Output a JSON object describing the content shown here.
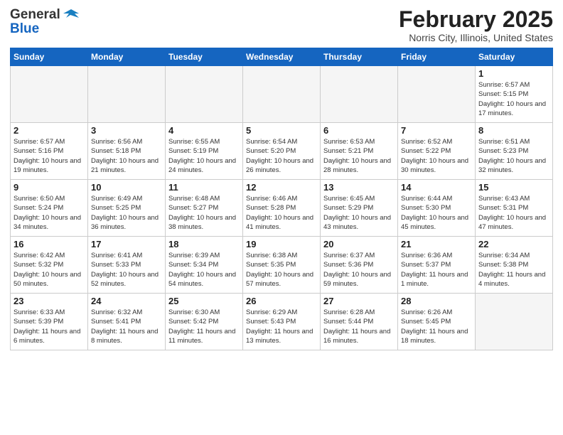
{
  "header": {
    "logo_general": "General",
    "logo_blue": "Blue",
    "title": "February 2025",
    "subtitle": "Norris City, Illinois, United States"
  },
  "days_of_week": [
    "Sunday",
    "Monday",
    "Tuesday",
    "Wednesday",
    "Thursday",
    "Friday",
    "Saturday"
  ],
  "weeks": [
    [
      {
        "day": "",
        "info": ""
      },
      {
        "day": "",
        "info": ""
      },
      {
        "day": "",
        "info": ""
      },
      {
        "day": "",
        "info": ""
      },
      {
        "day": "",
        "info": ""
      },
      {
        "day": "",
        "info": ""
      },
      {
        "day": "1",
        "info": "Sunrise: 6:57 AM\nSunset: 5:15 PM\nDaylight: 10 hours and 17 minutes."
      }
    ],
    [
      {
        "day": "2",
        "info": "Sunrise: 6:57 AM\nSunset: 5:16 PM\nDaylight: 10 hours and 19 minutes."
      },
      {
        "day": "3",
        "info": "Sunrise: 6:56 AM\nSunset: 5:18 PM\nDaylight: 10 hours and 21 minutes."
      },
      {
        "day": "4",
        "info": "Sunrise: 6:55 AM\nSunset: 5:19 PM\nDaylight: 10 hours and 24 minutes."
      },
      {
        "day": "5",
        "info": "Sunrise: 6:54 AM\nSunset: 5:20 PM\nDaylight: 10 hours and 26 minutes."
      },
      {
        "day": "6",
        "info": "Sunrise: 6:53 AM\nSunset: 5:21 PM\nDaylight: 10 hours and 28 minutes."
      },
      {
        "day": "7",
        "info": "Sunrise: 6:52 AM\nSunset: 5:22 PM\nDaylight: 10 hours and 30 minutes."
      },
      {
        "day": "8",
        "info": "Sunrise: 6:51 AM\nSunset: 5:23 PM\nDaylight: 10 hours and 32 minutes."
      }
    ],
    [
      {
        "day": "9",
        "info": "Sunrise: 6:50 AM\nSunset: 5:24 PM\nDaylight: 10 hours and 34 minutes."
      },
      {
        "day": "10",
        "info": "Sunrise: 6:49 AM\nSunset: 5:25 PM\nDaylight: 10 hours and 36 minutes."
      },
      {
        "day": "11",
        "info": "Sunrise: 6:48 AM\nSunset: 5:27 PM\nDaylight: 10 hours and 38 minutes."
      },
      {
        "day": "12",
        "info": "Sunrise: 6:46 AM\nSunset: 5:28 PM\nDaylight: 10 hours and 41 minutes."
      },
      {
        "day": "13",
        "info": "Sunrise: 6:45 AM\nSunset: 5:29 PM\nDaylight: 10 hours and 43 minutes."
      },
      {
        "day": "14",
        "info": "Sunrise: 6:44 AM\nSunset: 5:30 PM\nDaylight: 10 hours and 45 minutes."
      },
      {
        "day": "15",
        "info": "Sunrise: 6:43 AM\nSunset: 5:31 PM\nDaylight: 10 hours and 47 minutes."
      }
    ],
    [
      {
        "day": "16",
        "info": "Sunrise: 6:42 AM\nSunset: 5:32 PM\nDaylight: 10 hours and 50 minutes."
      },
      {
        "day": "17",
        "info": "Sunrise: 6:41 AM\nSunset: 5:33 PM\nDaylight: 10 hours and 52 minutes."
      },
      {
        "day": "18",
        "info": "Sunrise: 6:39 AM\nSunset: 5:34 PM\nDaylight: 10 hours and 54 minutes."
      },
      {
        "day": "19",
        "info": "Sunrise: 6:38 AM\nSunset: 5:35 PM\nDaylight: 10 hours and 57 minutes."
      },
      {
        "day": "20",
        "info": "Sunrise: 6:37 AM\nSunset: 5:36 PM\nDaylight: 10 hours and 59 minutes."
      },
      {
        "day": "21",
        "info": "Sunrise: 6:36 AM\nSunset: 5:37 PM\nDaylight: 11 hours and 1 minute."
      },
      {
        "day": "22",
        "info": "Sunrise: 6:34 AM\nSunset: 5:38 PM\nDaylight: 11 hours and 4 minutes."
      }
    ],
    [
      {
        "day": "23",
        "info": "Sunrise: 6:33 AM\nSunset: 5:39 PM\nDaylight: 11 hours and 6 minutes."
      },
      {
        "day": "24",
        "info": "Sunrise: 6:32 AM\nSunset: 5:41 PM\nDaylight: 11 hours and 8 minutes."
      },
      {
        "day": "25",
        "info": "Sunrise: 6:30 AM\nSunset: 5:42 PM\nDaylight: 11 hours and 11 minutes."
      },
      {
        "day": "26",
        "info": "Sunrise: 6:29 AM\nSunset: 5:43 PM\nDaylight: 11 hours and 13 minutes."
      },
      {
        "day": "27",
        "info": "Sunrise: 6:28 AM\nSunset: 5:44 PM\nDaylight: 11 hours and 16 minutes."
      },
      {
        "day": "28",
        "info": "Sunrise: 6:26 AM\nSunset: 5:45 PM\nDaylight: 11 hours and 18 minutes."
      },
      {
        "day": "",
        "info": ""
      }
    ]
  ]
}
